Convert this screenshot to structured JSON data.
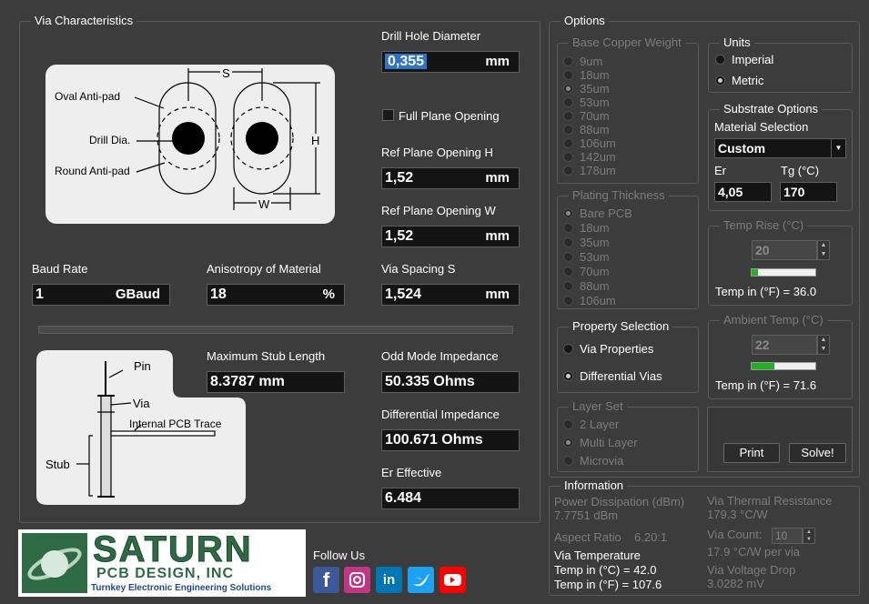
{
  "via": {
    "title": "Via Characteristics",
    "diagram": {
      "s": "S",
      "h": "H",
      "w": "W",
      "oval": "Oval Anti-pad",
      "drill": "Drill Dia.",
      "round": "Round Anti-pad"
    },
    "drill_label": "Drill Hole Diameter",
    "drill_value": "0,355",
    "drill_unit": "mm",
    "full_plane": "Full Plane Opening",
    "refh_label": "Ref Plane Opening H",
    "refh_value": "1,52",
    "refh_unit": "mm",
    "refw_label": "Ref Plane Opening W",
    "refw_value": "1,52",
    "refw_unit": "mm",
    "baud_label": "Baud Rate",
    "baud_value": "1",
    "baud_unit": "GBaud",
    "aniso_label": "Anisotropy of Material",
    "aniso_value": "18",
    "aniso_unit": "%",
    "spacing_label": "Via Spacing S",
    "spacing_value": "1,524",
    "spacing_unit": "mm",
    "stub_diagram": {
      "pin": "Pin",
      "via": "Via",
      "trace": "Internal PCB Trace",
      "stub": "Stub"
    },
    "stub_label": "Maximum Stub Length",
    "stub_value": "8.3787 mm",
    "odd_label": "Odd Mode Impedance",
    "odd_value": "50.335 Ohms",
    "diff_label": "Differential Impedance",
    "diff_value": "100.671 Ohms",
    "er_label": "Er Effective",
    "er_value": "6.484"
  },
  "logo": {
    "name": "SATURN",
    "sub": "PCB DESIGN, INC",
    "tagline": "Turnkey Electronic Engineering Solutions"
  },
  "social": {
    "follow": "Follow Us",
    "icons": [
      "facebook-icon",
      "instagram-icon",
      "linkedin-icon",
      "twitter-icon",
      "youtube-icon"
    ]
  },
  "options": {
    "title": "Options",
    "copper": {
      "title": "Base Copper Weight",
      "items": [
        "9um",
        "18um",
        "35um",
        "53um",
        "70um",
        "88um",
        "106um",
        "142um",
        "178um"
      ],
      "selected": "35um"
    },
    "plating": {
      "title": "Plating Thickness",
      "items": [
        "Bare PCB",
        "18um",
        "35um",
        "53um",
        "70um",
        "88um",
        "106um"
      ],
      "selected": "Bare PCB"
    },
    "units": {
      "title": "Units",
      "items": [
        "Imperial",
        "Metric"
      ],
      "selected": "Metric"
    },
    "substrate": {
      "title": "Substrate Options",
      "material_label": "Material Selection",
      "material_value": "Custom",
      "er_label": "Er",
      "er_value": "4,05",
      "tg_label": "Tg (°C)",
      "tg_value": "170"
    },
    "temp_rise": {
      "title": "Temp Rise (°C)",
      "value": "20",
      "progress": 0.1,
      "readout": "Temp in (°F) = 36.0"
    },
    "ambient": {
      "title": "Ambient Temp (°C)",
      "value": "22",
      "progress": 0.36,
      "readout": "Temp in (°F) = 71.6"
    },
    "property": {
      "title": "Property Selection",
      "items": [
        "Via Properties",
        "Differential Vias"
      ],
      "selected": "Differential Vias"
    },
    "layer": {
      "title": "Layer Set",
      "items": [
        "2 Layer",
        "Multi Layer",
        "Microvia"
      ],
      "selected": "Multi Layer"
    },
    "print": "Print",
    "solve": "Solve!"
  },
  "info": {
    "title": "Information",
    "power_label": "Power Dissipation (dBm)",
    "power_value": "7.7751 dBm",
    "aspect_label": "Aspect Ratio",
    "aspect_value": "6.20:1",
    "viatemp_label": "Via Temperature",
    "viatemp_c": "Temp in (°C) = 42.0",
    "viatemp_f": "Temp in (°F) = 107.6",
    "thermal_label": "Via Thermal Resistance",
    "thermal_value": "179.3 °C/W",
    "count_label": "Via Count:",
    "count_value": "10",
    "count_per": "17.9 °C/W per via",
    "drop_label": "Via Voltage Drop",
    "drop_value": "3.0282 mV"
  },
  "colors": {
    "facebook": "#3b5998",
    "instagram": "#c13584",
    "linkedin": "#0077b5",
    "twitter": "#1da1f2",
    "youtube": "#ff0000",
    "logo_green": "#2e6b45"
  }
}
